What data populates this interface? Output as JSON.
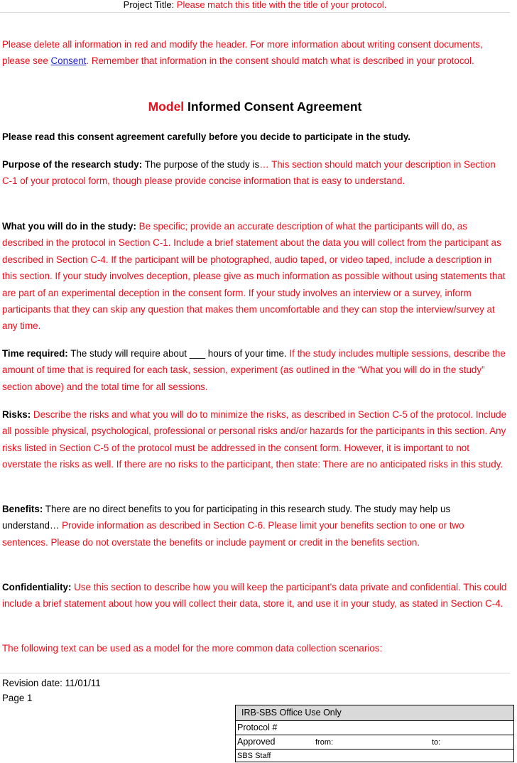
{
  "header": {
    "prefix": "Project Title: ",
    "placeholder": "Please match this title with the title of your protocol."
  },
  "intro": {
    "before_link": "Please delete all information in red and modify the header.  For more information about writing consent documents, please see ",
    "link": "Consent",
    "after_link": ". Remember that information in the consent should match what is described in your protocol."
  },
  "title": {
    "red": "Model",
    "black": " Informed Consent Agreement"
  },
  "read_notice": "Please read this consent agreement carefully before you decide to participate in the study.",
  "purpose": {
    "label": "Purpose of the research study:",
    "black": " The purpose of the study is",
    "red": "… This section should match your description in Section C-1 of your protocol form, though please provide concise information that is easy to understand."
  },
  "what": {
    "label": "What you will do in the study:",
    "red": " Be specific; provide an accurate description of what the participants will do, as described in the protocol in Section C-1.  Include a brief statement about the data you will collect from the participant as described in Section C-4. If the participant will be photographed, audio taped, or video taped, include a description in this section.  If your study involves deception, please give as much information as possible without using statements that are part of an experimental deception in the consent form. If your study involves an interview or a survey, inform participants that they can skip any question that makes them uncomfortable and they can stop the interview/survey at any time."
  },
  "time": {
    "label": "Time required:",
    "black": " The study will require about ___   hours of your time.",
    "red": " If the study includes multiple sessions, describe the amount of time that is required for each task, session, experiment (as outlined in the “What you will do in the study” section above) and the total time for all sessions."
  },
  "risks": {
    "label": "Risks:",
    "red": " Describe the risks and what you will do to minimize the risks, as described in Section C-5 of the protocol. Include all possible physical, psychological, professional or personal risks and/or hazards for the participants in this section.  Any risks listed in Section C-5 of the protocol must be addressed in the consent form. However, it is important to not overstate the risks as well. If there are no risks to the participant, then state: There are no anticipated risks in this study."
  },
  "benefits": {
    "label": "Benefits:",
    "black": " There are no direct benefits to you for participating in this research study.  The study may help us understand…  ",
    "red": "Provide information as described in Section C-6. Please limit your benefits section to one or two sentences. Please do not overstate the benefits or include payment or credit in the benefits section."
  },
  "confidentiality": {
    "label": "Confidentiality:",
    "red": " Use this section to describe how you will keep the participant’s data private and confidential. This could include a brief statement about how you will collect their data, store it, and use it in your study, as stated in Section C-4."
  },
  "model_text": "The following text can be used as a model for the more common data collection scenarios:",
  "footer": {
    "revision": "Revision date: 11/01/11",
    "page": "Page 1"
  },
  "office": {
    "title": "IRB-SBS Office Use Only",
    "protocol": "Protocol #",
    "approved": "Approved",
    "from": "from:",
    "to": "to:",
    "staff": "SBS Staff"
  },
  "colors": {
    "placeholder_red": "#e8101c",
    "link_blue": "#1f1fd0",
    "rule_gray": "#d9d9d9"
  }
}
